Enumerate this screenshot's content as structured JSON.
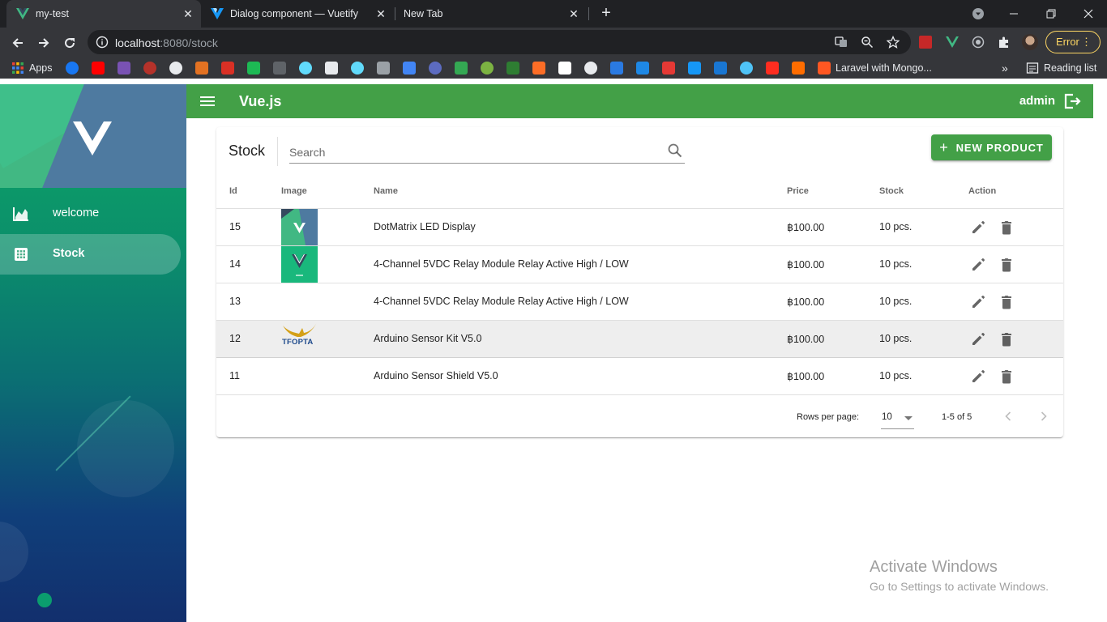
{
  "browser": {
    "tabs": [
      {
        "title": "my-test",
        "icon": "vue-logo-icon",
        "active": true
      },
      {
        "title": "Dialog component — Vuetify",
        "icon": "vuetify-logo-icon",
        "active": false
      },
      {
        "title": "New Tab",
        "icon": "",
        "active": false
      }
    ],
    "new_tab_label": "+",
    "url_host": "localhost",
    "url_path": ":8080/stock",
    "error_label": "Error",
    "bookmarks": {
      "apps_label": "Apps",
      "laravel_label": "Laravel with Mongo...",
      "overflow_label": "»",
      "reading_list_label": "Reading list"
    }
  },
  "app": {
    "title": "Vue.js",
    "user": "admin",
    "sidebar": {
      "items": [
        {
          "label": "welcome",
          "icon": "chart-line-icon",
          "active": false
        },
        {
          "label": "Stock",
          "icon": "grid-icon",
          "active": true
        }
      ]
    },
    "stock": {
      "title": "Stock",
      "search_placeholder": "Search",
      "new_product_label": "NEW PRODUCT",
      "headers": {
        "id": "Id",
        "image": "Image",
        "name": "Name",
        "price": "Price",
        "stock": "Stock",
        "action": "Action"
      },
      "rows": [
        {
          "id": "15",
          "image": "vue-thumb",
          "name": "DotMatrix LED Display",
          "price": "฿100.00",
          "stock": "10 pcs."
        },
        {
          "id": "14",
          "image": "vue-thumb-green",
          "name": "4-Channel 5VDC Relay Module Relay Active High / LOW",
          "price": "฿100.00",
          "stock": "10 pcs."
        },
        {
          "id": "13",
          "image": "",
          "name": "4-Channel 5VDC Relay Module Relay Active High / LOW",
          "price": "฿100.00",
          "stock": "10 pcs."
        },
        {
          "id": "12",
          "image": "tfopta-logo",
          "name": "Arduino Sensor Kit V5.0",
          "price": "฿100.00",
          "stock": "10 pcs."
        },
        {
          "id": "11",
          "image": "",
          "name": "Arduino Sensor Shield V5.0",
          "price": "฿100.00",
          "stock": "10 pcs."
        }
      ],
      "tfopta_text": "TFOPTA",
      "footer": {
        "rows_per_page_label": "Rows per page:",
        "rows_per_page_value": "10",
        "range": "1-5 of 5"
      }
    }
  },
  "watermark": {
    "line1": "Activate Windows",
    "line2": "Go to Settings to activate Windows."
  },
  "colors": {
    "primary": "#43a047",
    "vue_green": "#41b883",
    "vue_dark": "#35495e",
    "browser_bg": "#202124",
    "toolbar_bg": "#35363a"
  }
}
